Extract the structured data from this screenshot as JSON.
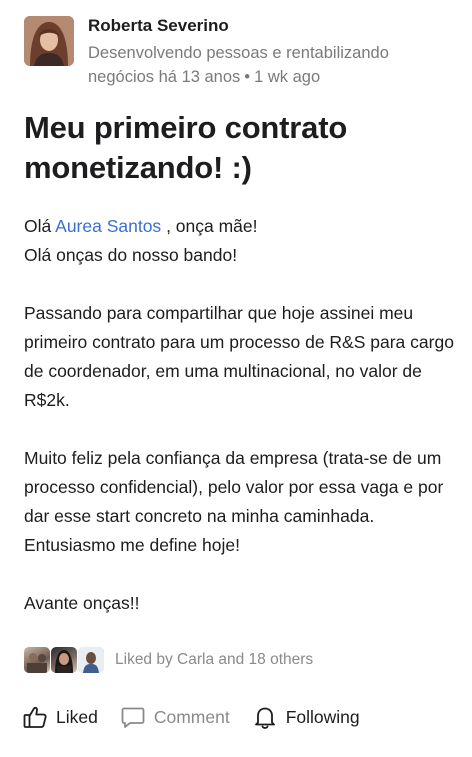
{
  "post": {
    "author": {
      "name": "Roberta Severino",
      "headline": "Desenvolvendo pessoas e rentabilizando negócios há 13 anos",
      "time": "1 wk ago"
    },
    "title": "Meu primeiro contrato monetizando! :)",
    "body": {
      "greeting_prefix": "Olá",
      "mention": "Aurea Santos",
      "greeting_suffix": ", onça mãe!",
      "line2": "Olá onças do nosso bando!",
      "paragraph2": "Passando para compartilhar que hoje assinei meu primeiro contrato para um processo de R&S para cargo de coordenador, em uma multinacional, no valor de R$2k.",
      "paragraph3": "Muito feliz pela confiança da empresa (trata-se de um processo confidencial), pelo valor por essa vaga e por dar esse start concreto na minha caminhada. Entusiasmo me define hoje!",
      "closing": "Avante onças!!"
    },
    "reactions": {
      "text": "Liked by Carla and 18 others"
    },
    "actions": {
      "liked": "Liked",
      "comment": "Comment",
      "following": "Following"
    }
  },
  "colors": {
    "mention": "#3a6fd1",
    "muted": "#8a8a8a",
    "text": "#1d1d1f"
  },
  "icons": {
    "liked": "thumbs-up-icon",
    "comment": "speech-bubble-icon",
    "following": "bell-icon"
  }
}
